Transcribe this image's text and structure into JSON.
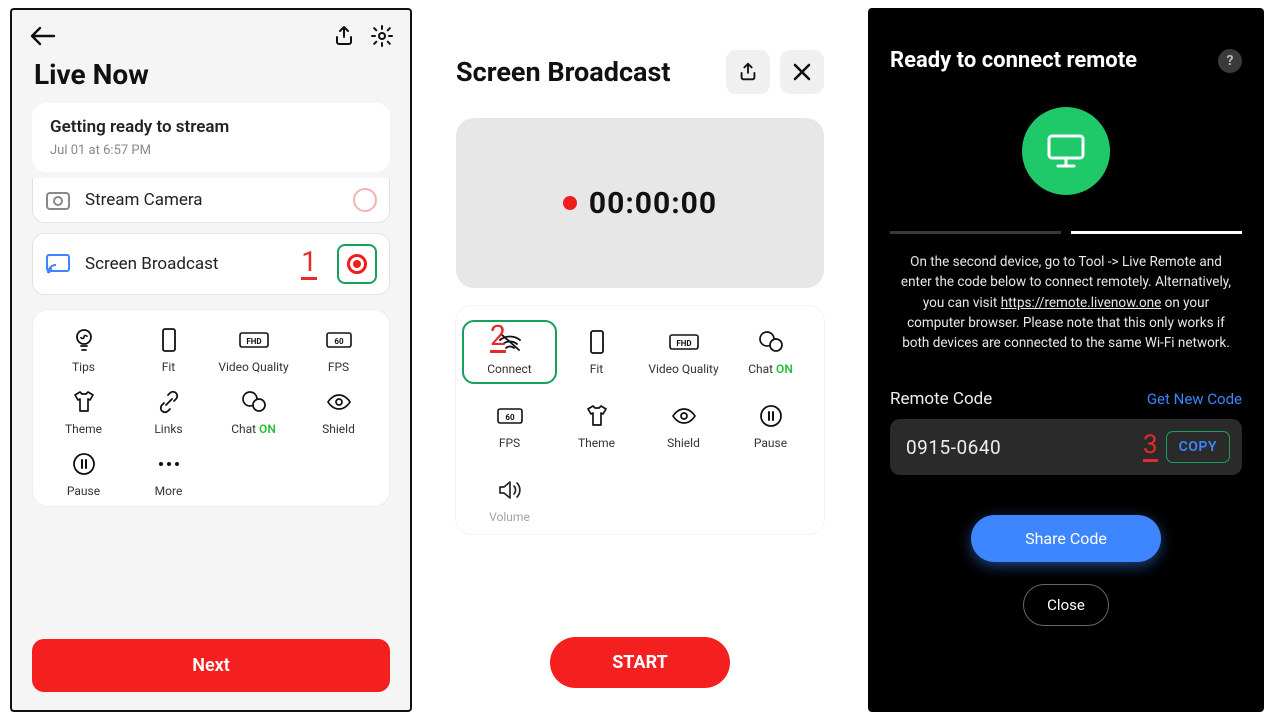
{
  "panel1": {
    "title": "Live Now",
    "card": {
      "title": "Getting ready to stream",
      "sub": "Jul 01 at 6:57 PM"
    },
    "opt1": "Stream Camera",
    "opt2": "Screen Broadcast",
    "step": "1",
    "tools": {
      "tips": "Tips",
      "fit": "Fit",
      "vq": "Video Quality",
      "fps": "FPS",
      "theme": "Theme",
      "links": "Links",
      "chat": "Chat ",
      "chat_on": "ON",
      "shield": "Shield",
      "pause": "Pause",
      "more": "More"
    },
    "next": "Next"
  },
  "panel2": {
    "title": "Screen Broadcast",
    "timer": "00:00:00",
    "step": "2",
    "tools": {
      "connect": "Connect",
      "fit": "Fit",
      "vq": "Video Quality",
      "chat": "Chat ",
      "chat_on": "ON",
      "fps": "FPS",
      "theme": "Theme",
      "shield": "Shield",
      "pause": "Pause",
      "volume": "Volume"
    },
    "start": "START"
  },
  "panel3": {
    "title": "Ready to connect remote",
    "instr_a": "On the second device, go to Tool -> Live Remote and enter the code below to connect remotely. Alternatively, you can visit ",
    "instr_url": "https://remote.livenow.one",
    "instr_b": " on your computer browser. Please note that this only works if both devices are connected to the same Wi-Fi network.",
    "code_label": "Remote Code",
    "get_new": "Get New Code",
    "code": "0915-0640",
    "step": "3",
    "copy": "COPY",
    "share": "Share Code",
    "close": "Close"
  }
}
